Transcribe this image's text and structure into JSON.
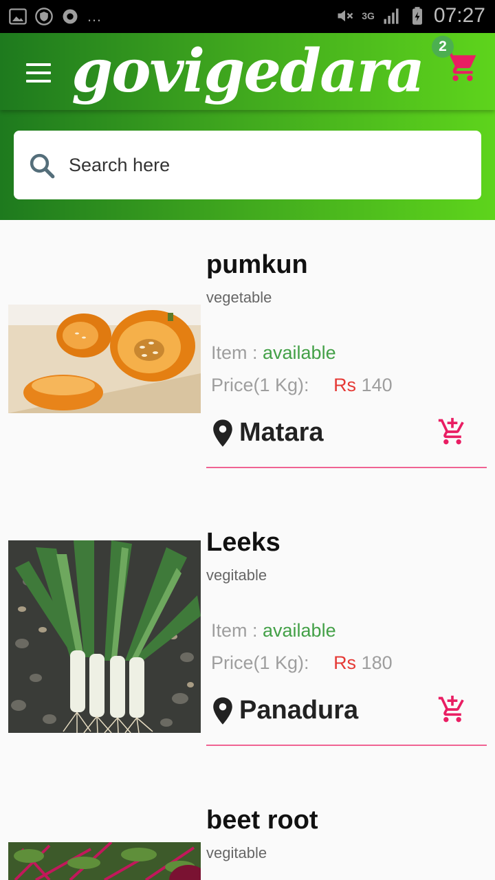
{
  "status_bar": {
    "time": "07:27",
    "network": "3G",
    "icons": [
      "image-icon",
      "shield-icon",
      "sync-icon",
      "more-dots-icon",
      "mute-icon",
      "signal-icon",
      "battery-charging-icon"
    ]
  },
  "header": {
    "title": "govigedara",
    "cart_count": "2",
    "menu_icon": "hamburger-menu-icon",
    "cart_icon": "shopping-cart-icon",
    "colors": {
      "gradient_start": "#1e7a1e",
      "gradient_end": "#5ed41c",
      "cart": "#e91e63",
      "badge": "#4caf50"
    }
  },
  "search": {
    "placeholder": "Search here",
    "value": "",
    "icon": "search-icon"
  },
  "products": [
    {
      "name": "pumkun",
      "category": "vegetable",
      "item_label": "Item : ",
      "availability": "available",
      "price_label": "Price(1 Kg):",
      "currency": "Rs",
      "price": "140",
      "location": "Matara",
      "image": "pumpkin-photo"
    },
    {
      "name": "Leeks",
      "category": "vegitable",
      "item_label": "Item : ",
      "availability": "available",
      "price_label": "Price(1 Kg):",
      "currency": "Rs",
      "price": "180",
      "location": "Panadura",
      "image": "leeks-photo"
    },
    {
      "name": "beet root",
      "category": "vegitable",
      "image": "beetroot-photo"
    }
  ],
  "colors": {
    "available": "#43a047",
    "currency": "#e53935",
    "divider": "#f06292",
    "add_cart": "#e91e63"
  }
}
